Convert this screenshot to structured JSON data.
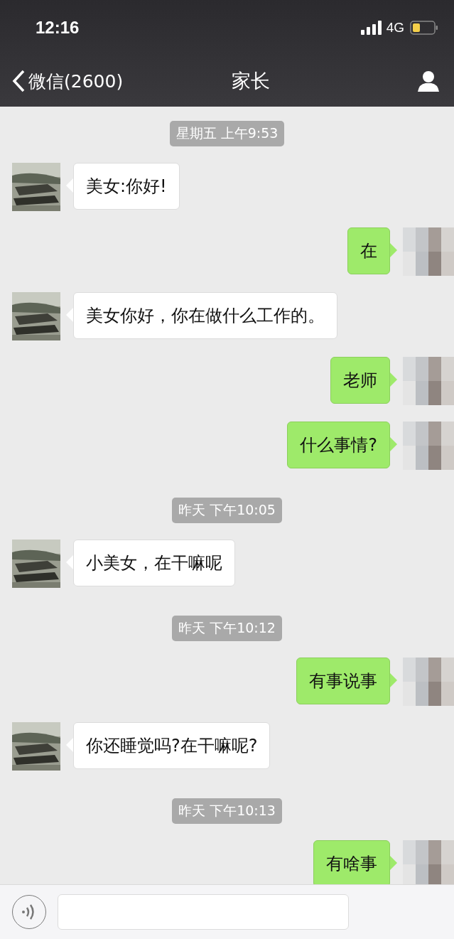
{
  "status_bar": {
    "time": "12:16",
    "network": "4G"
  },
  "nav": {
    "back_label": "微信(2600)",
    "title": "家长"
  },
  "messages": [
    {
      "kind": "time",
      "text": "星期五 上午9:53"
    },
    {
      "kind": "received",
      "text": "美女:你好!"
    },
    {
      "kind": "sent",
      "text": "在"
    },
    {
      "kind": "received",
      "text": "美女你好，你在做什么工作的。"
    },
    {
      "kind": "sent",
      "text": "老师"
    },
    {
      "kind": "sent",
      "text": "什么事情?"
    },
    {
      "kind": "time",
      "text": "昨天 下午10:05"
    },
    {
      "kind": "received",
      "text": "小美女，在干嘛呢"
    },
    {
      "kind": "time",
      "text": "昨天 下午10:12"
    },
    {
      "kind": "sent",
      "text": "有事说事"
    },
    {
      "kind": "received",
      "text": "你还睡觉吗?在干嘛呢?"
    },
    {
      "kind": "time",
      "text": "昨天 下午10:13"
    },
    {
      "kind": "sent",
      "text": "有啥事"
    }
  ]
}
